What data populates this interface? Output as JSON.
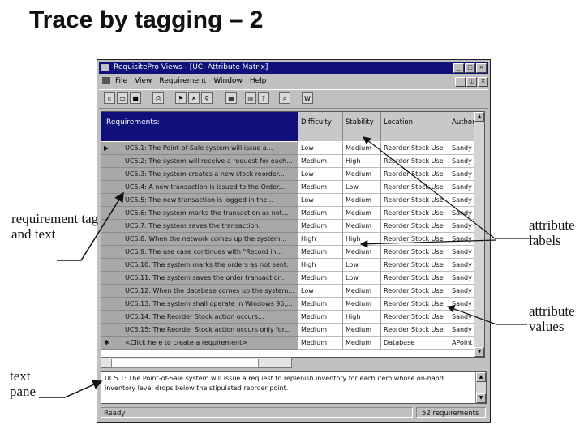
{
  "slide_title": "Trace by tagging – 2",
  "window": {
    "title": "RequisitePro Views - [UC: Attribute Matrix]",
    "menu": [
      "File",
      "View",
      "Requirement",
      "Window",
      "Help"
    ],
    "toolbar_icons": [
      "new-icon",
      "open-icon",
      "save-icon",
      "print-icon",
      "tag-icon",
      "cut-icon",
      "filter-icon",
      "table-icon",
      "grid-icon",
      "query-icon",
      "find-icon",
      "word-icon"
    ],
    "grid": {
      "req_header": "Requirements:",
      "columns": [
        "Difficulty",
        "Stability",
        "Location",
        "Author"
      ],
      "rows": [
        {
          "marker": "▶",
          "req": "UC5.1: The Point-of-Sale system will issue a...",
          "vals": [
            "Low",
            "Medium",
            "Reorder Stock Use",
            "Sandy"
          ]
        },
        {
          "marker": "",
          "req": "UC5.2: The system will receive a request for each...",
          "vals": [
            "Medium",
            "High",
            "Reorder Stock Use",
            "Sandy"
          ]
        },
        {
          "marker": "",
          "req": "UC5.3: The system creates a new stock reorder...",
          "vals": [
            "Low",
            "Medium",
            "Reorder Stock Use",
            "Sandy"
          ]
        },
        {
          "marker": "",
          "req": "UC5.4: A new transaction is issued to the Order...",
          "vals": [
            "Medium",
            "Low",
            "Reorder Stock Use",
            "Sandy"
          ]
        },
        {
          "marker": "",
          "req": "UC5.5: The new transaction is logged in the...",
          "vals": [
            "Low",
            "Medium",
            "Reorder Stock Use",
            "Sandy"
          ]
        },
        {
          "marker": "",
          "req": "UC5.6: The system marks the transaction as not...",
          "vals": [
            "Medium",
            "Medium",
            "Reorder Stock Use",
            "Sandy"
          ]
        },
        {
          "marker": "",
          "req": "UC5.7: The system saves the transaction.",
          "vals": [
            "Medium",
            "Medium",
            "Reorder Stock Use",
            "Sandy"
          ]
        },
        {
          "marker": "",
          "req": "UC5.8: When the network comes up the system...",
          "vals": [
            "High",
            "High",
            "Reorder Stock Use",
            "Sandy"
          ]
        },
        {
          "marker": "",
          "req": "UC5.9: The use case continues with \"Record in...",
          "vals": [
            "Medium",
            "Medium",
            "Reorder Stock Use",
            "Sandy"
          ]
        },
        {
          "marker": "",
          "req": "UC5.10: The system marks the orders as not sent.",
          "vals": [
            "High",
            "Low",
            "Reorder Stock Use",
            "Sandy"
          ]
        },
        {
          "marker": "",
          "req": "UC5.11: The system saves the order transaction.",
          "vals": [
            "Medium",
            "Low",
            "Reorder Stock Use",
            "Sandy"
          ]
        },
        {
          "marker": "",
          "req": "UC5.12: When the database comes up the system...",
          "vals": [
            "Low",
            "Medium",
            "Reorder Stock Use",
            "Sandy"
          ]
        },
        {
          "marker": "",
          "req": "UC5.13: The system shall operate in Windows 95,...",
          "vals": [
            "Medium",
            "Medium",
            "Reorder Stock Use",
            "Sandy"
          ]
        },
        {
          "marker": "",
          "req": "UC5.14: The Reorder Stock action occurs...",
          "vals": [
            "Medium",
            "High",
            "Reorder Stock Use",
            "Sandy"
          ]
        },
        {
          "marker": "",
          "req": "UC5.15: The Reorder Stock action occurs only for...",
          "vals": [
            "Medium",
            "Medium",
            "Reorder Stock Use",
            "Sandy"
          ]
        },
        {
          "marker": "✱",
          "req": "<Click here to create a requirement>",
          "vals": [
            "Medium",
            "Medium",
            "Database",
            "APoint"
          ]
        }
      ]
    },
    "text_pane": "UC5.1: The Point-of-Sale system will issue a request to replenish inventory for each item whose on-hand inventory level drops below the stipulated reorder point.",
    "status_left": "Ready",
    "status_right": "52 requirements"
  },
  "annotations": {
    "req_tag": "requirement tag and text",
    "attr_labels": "attribute labels",
    "attr_values": "attribute values",
    "text_pane": "text pane"
  },
  "colors": {
    "selected_header": "#10107a",
    "window_chrome": "#c0c0c0"
  }
}
